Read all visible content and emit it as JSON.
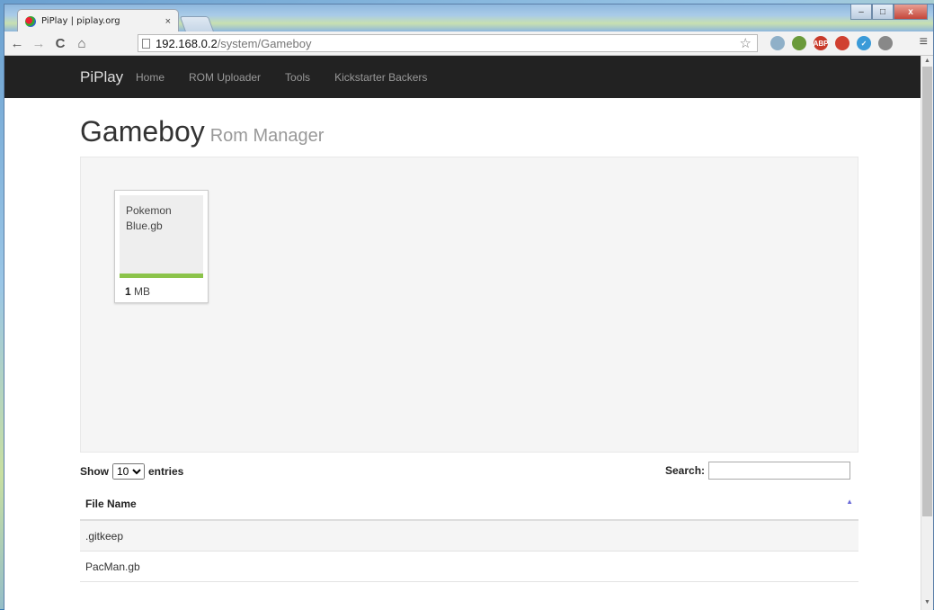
{
  "browser": {
    "tab_title": "PiPlay | piplay.org",
    "tab_close": "×",
    "url_host": "192.168.0.2",
    "url_path": "/system/Gameboy",
    "window_controls": {
      "minimize": "–",
      "maximize": "□",
      "close": "x"
    },
    "extensions": [
      {
        "name": "search-extension-icon",
        "glyph": "",
        "color": "#8fb0c8"
      },
      {
        "name": "evernote-extension-icon",
        "glyph": "",
        "color": "#6a9a3a"
      },
      {
        "name": "adblock-extension-icon",
        "glyph": "ABP",
        "color": "#c83a2a"
      },
      {
        "name": "puzzle-extension-icon",
        "glyph": "",
        "color": "#d04030"
      },
      {
        "name": "checkmark-extension-icon",
        "glyph": "✓",
        "color": "#3a9ad8"
      },
      {
        "name": "cast-extension-icon",
        "glyph": "",
        "color": "#888888"
      }
    ]
  },
  "navbar": {
    "brand": "PiPlay",
    "links": [
      "Home",
      "ROM Uploader",
      "Tools",
      "Kickstarter Backers"
    ]
  },
  "page": {
    "title": "Gameboy",
    "subtitle": "Rom Manager"
  },
  "rom_card": {
    "name": "Pokemon Blue.gb",
    "size_value": "1",
    "size_unit": "MB",
    "progress_fraction": 1.0
  },
  "table_controls": {
    "show_label": "Show",
    "entries_selected": "10",
    "entries_label": "entries",
    "search_label": "Search:"
  },
  "table": {
    "header": "File Name",
    "rows": [
      ".gitkeep",
      "PacMan.gb"
    ]
  },
  "colors": {
    "navbar_bg": "#222222",
    "progress": "#8bc34a"
  }
}
